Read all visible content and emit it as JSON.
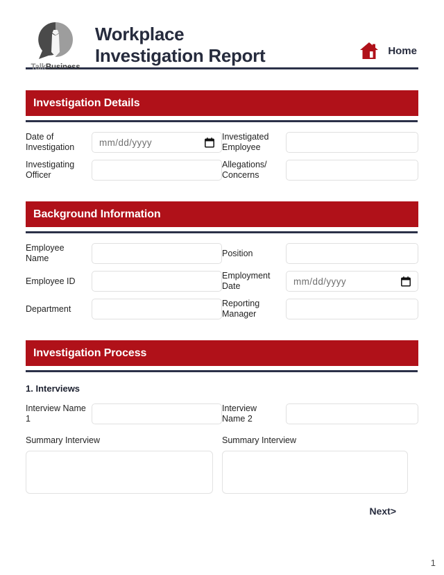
{
  "header": {
    "logo": {
      "icon_name": "talkbusiness-logo",
      "word_first": "Talk",
      "word_second": "Business"
    },
    "title_line1": "Workplace",
    "title_line2": "Investigation Report",
    "home": {
      "icon_name": "home-icon",
      "label": "Home"
    }
  },
  "sections": [
    {
      "title": "Investigation Details",
      "rows": [
        {
          "left": {
            "label": "Date of Investigation",
            "type": "date",
            "value": "",
            "placeholder": "mm/dd/yyyy"
          },
          "right": {
            "label": "Investigated Employee",
            "type": "text",
            "value": "",
            "placeholder": ""
          }
        },
        {
          "left": {
            "label": "Investigating Officer",
            "type": "text",
            "value": "",
            "placeholder": ""
          },
          "right": {
            "label": "Allegations/ Concerns",
            "type": "text",
            "value": "",
            "placeholder": ""
          }
        }
      ]
    },
    {
      "title": "Background Information",
      "rows": [
        {
          "left": {
            "label": "Employee Name",
            "type": "text",
            "value": "",
            "placeholder": ""
          },
          "right": {
            "label": "Position",
            "type": "text",
            "value": "",
            "placeholder": ""
          }
        },
        {
          "left": {
            "label": "Employee ID",
            "type": "text",
            "value": "",
            "placeholder": ""
          },
          "right": {
            "label": "Employment Date",
            "type": "date",
            "value": "",
            "placeholder": "mm/dd/yyyy"
          }
        },
        {
          "left": {
            "label": "Department",
            "type": "text",
            "value": "",
            "placeholder": ""
          },
          "right": {
            "label": "Reporting Manager",
            "type": "text",
            "value": "",
            "placeholder": ""
          }
        }
      ]
    },
    {
      "title": "Investigation Process",
      "subheading": "1. Interviews",
      "rows": [
        {
          "left": {
            "label": "Interview Name 1",
            "type": "text",
            "value": "",
            "placeholder": ""
          },
          "right": {
            "label": "Interview Name 2",
            "type": "text",
            "value": "",
            "placeholder": ""
          }
        }
      ],
      "textareas": {
        "left_label": "Summary Interview",
        "left_value": "",
        "right_label": "Summary Interview",
        "right_value": ""
      }
    }
  ],
  "footer": {
    "next_label": "Next>",
    "page_number": "1"
  },
  "colors": {
    "accent_red": "#b01119",
    "rule_navy": "#2b3148",
    "heading": "#262b3d",
    "input_border": "#e0e0e0"
  }
}
